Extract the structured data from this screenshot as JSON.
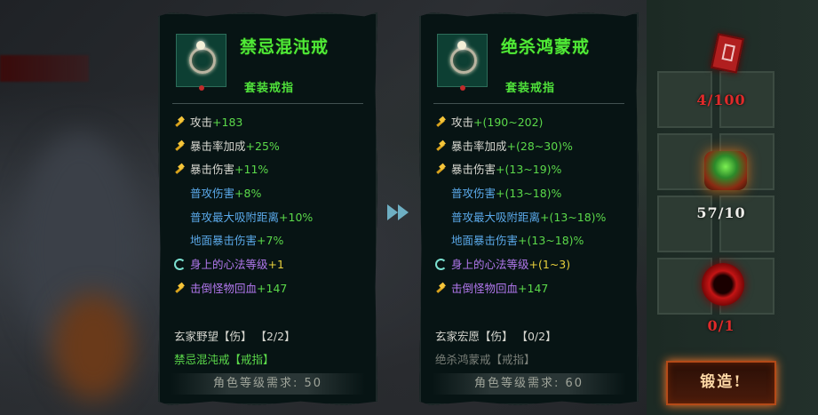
{
  "left_item": {
    "title": "禁忌混沌戒",
    "subtitle": "套装戒指",
    "stats": [
      {
        "icon": "hammer-icon",
        "label": "攻击",
        "value": "+183",
        "color": "white"
      },
      {
        "icon": "hammer-icon",
        "label": "暴击率加成",
        "value": "+25%",
        "color": "white"
      },
      {
        "icon": "hammer-icon",
        "label": "暴击伤害",
        "value": "+11%",
        "color": "white"
      },
      {
        "icon": "",
        "label": "普攻伤害",
        "value": "+8%",
        "color": "cyan"
      },
      {
        "icon": "",
        "label": "普攻最大吸附距离",
        "value": "+10%",
        "color": "cyan"
      },
      {
        "icon": "",
        "label": "地面暴击伤害",
        "value": "+7%",
        "color": "cyan"
      },
      {
        "icon": "swirl-icon",
        "label": "身上的心法等级",
        "value": "+1",
        "color": "purple",
        "value_color": "yellow"
      },
      {
        "icon": "hammer-icon",
        "label": "击倒怪物回血",
        "value": "+147",
        "color": "purple"
      }
    ],
    "set_name": "玄家野望【伤】 【2/2】",
    "set_item": "禁忌混沌戒【戒指】",
    "set_item_color": "#5bd94a",
    "requirement": "角色等级需求: 50"
  },
  "right_item": {
    "title": "绝杀鸿蒙戒",
    "subtitle": "套装戒指",
    "stats": [
      {
        "icon": "hammer-icon",
        "label": "攻击",
        "value": "+(190~202)",
        "color": "white"
      },
      {
        "icon": "hammer-icon",
        "label": "暴击率加成",
        "value": "+(28~30)%",
        "color": "white"
      },
      {
        "icon": "hammer-icon",
        "label": "暴击伤害",
        "value": "+(13~19)%",
        "color": "white"
      },
      {
        "icon": "",
        "label": "普攻伤害",
        "value": "+(13~18)%",
        "color": "cyan"
      },
      {
        "icon": "",
        "label": "普攻最大吸附距离",
        "value": "+(13~18)%",
        "color": "cyan"
      },
      {
        "icon": "",
        "label": "地面暴击伤害",
        "value": "+(13~18)%",
        "color": "cyan"
      },
      {
        "icon": "swirl-icon",
        "label": "身上的心法等级",
        "value": "+(1~3)",
        "color": "purple",
        "value_color": "yellow"
      },
      {
        "icon": "hammer-icon",
        "label": "击倒怪物回血",
        "value": "+147",
        "color": "purple"
      }
    ],
    "set_name": "玄家宏愿【伤】 【0/2】",
    "set_item": "绝杀鸿蒙戒【戒指】",
    "set_item_color": "#7a7f78",
    "requirement": "角色等级需求: 60"
  },
  "resources": [
    {
      "icon": "red-book-icon",
      "count": "4/100",
      "color": "red"
    },
    {
      "icon": "green-drum-icon",
      "count": "57/10",
      "color": "white"
    },
    {
      "icon": "red-orb-icon",
      "count": "0/1",
      "color": "red"
    }
  ],
  "forge_button": "锻造!",
  "colors": {
    "title_green": "#4fea36",
    "stat_white": "#d7d7d0",
    "stat_cyan": "#5aa8e8",
    "stat_purple": "#b278ee",
    "value_green": "#5bd94a",
    "value_yellow": "#e8d03c",
    "count_red": "#e02a2a"
  }
}
